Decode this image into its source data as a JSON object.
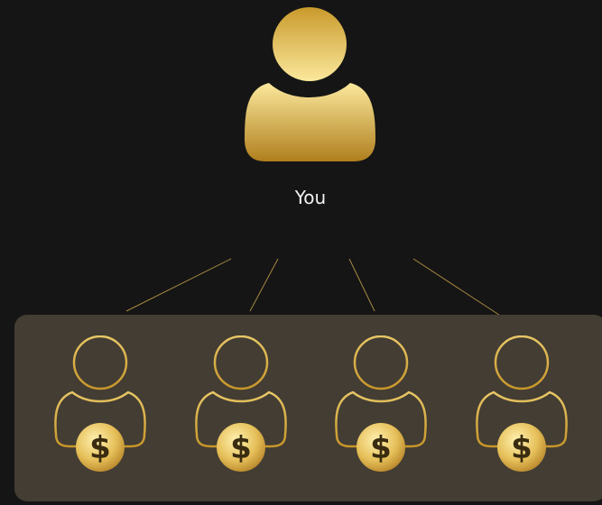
{
  "root": {
    "label": "You",
    "icon": "user-icon"
  },
  "members": [
    {
      "icon": "user-outline-icon",
      "badge_icon": "dollar-coin-icon",
      "badge_symbol": "$"
    },
    {
      "icon": "user-outline-icon",
      "badge_icon": "dollar-coin-icon",
      "badge_symbol": "$"
    },
    {
      "icon": "user-outline-icon",
      "badge_icon": "dollar-coin-icon",
      "badge_symbol": "$"
    },
    {
      "icon": "user-outline-icon",
      "badge_icon": "dollar-coin-icon",
      "badge_symbol": "$"
    }
  ],
  "colors": {
    "background": "#151515",
    "panel": "#433d33",
    "gold_light": "#fbe89c",
    "gold_dark": "#b07f1e",
    "label_text": "#f2f2f2"
  }
}
